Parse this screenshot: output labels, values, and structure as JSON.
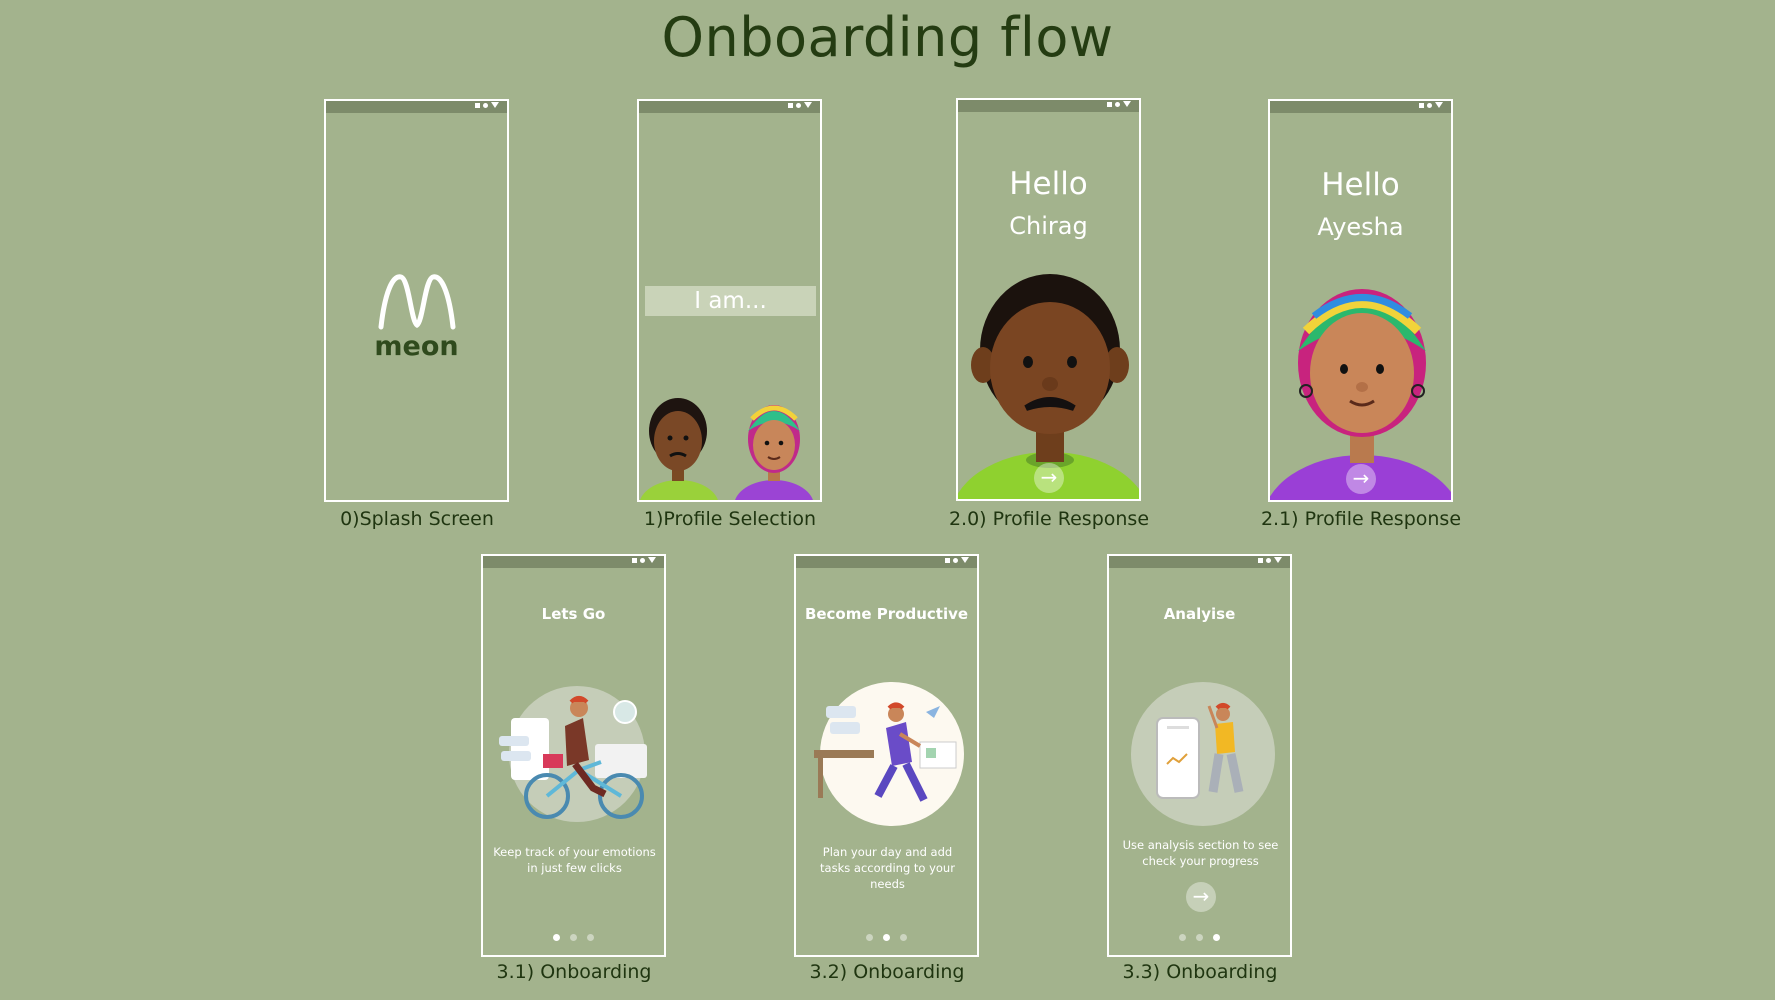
{
  "page": {
    "title": "Onboarding flow"
  },
  "colors": {
    "background": "#a3b38d",
    "title": "#243c12",
    "frame": "#ffffff"
  },
  "screens": [
    {
      "caption": "0)Splash Screen",
      "logo_text": "meon"
    },
    {
      "caption": "1)Profile Selection",
      "prompt": "I am..."
    },
    {
      "caption": "2.0) Profile Response",
      "greeting": "Hello",
      "name": "Chirag"
    },
    {
      "caption": "2.1) Profile Response",
      "greeting": "Hello",
      "name": "Ayesha"
    },
    {
      "caption": "3.1) Onboarding",
      "title": "Lets Go",
      "description": "Keep track of your emotions in just few clicks",
      "active_page": 1
    },
    {
      "caption": "3.2) Onboarding",
      "title": "Become Productive",
      "description": "Plan your day and add tasks according to your needs",
      "active_page": 2
    },
    {
      "caption": "3.3) Onboarding",
      "title": "Analyise",
      "description": "Use analysis section to see check your progress",
      "active_page": 3
    }
  ],
  "icons": {
    "status_bar": [
      "signal-icon",
      "wifi-icon",
      "battery-icon"
    ],
    "next": "arrow-right-icon"
  }
}
